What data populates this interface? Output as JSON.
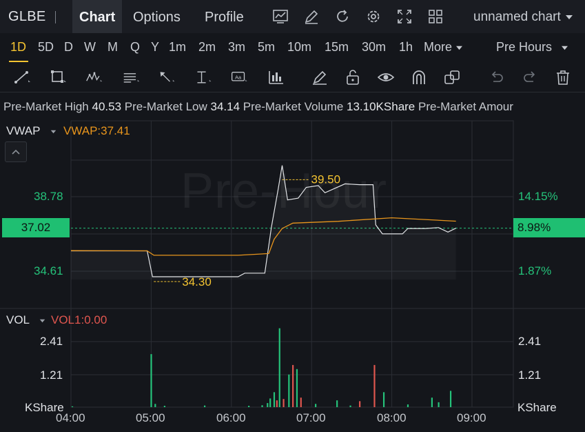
{
  "header": {
    "ticker": "GLBE",
    "tabs": [
      {
        "label": "Chart",
        "active": true
      },
      {
        "label": "Options",
        "active": false
      },
      {
        "label": "Profile",
        "active": false
      }
    ],
    "icons": [
      "chart-type-icon",
      "draw-pen-icon",
      "refresh-icon",
      "settings-gear-icon",
      "fullscreen-icon",
      "layout-grid-icon"
    ],
    "chart_name": "unnamed chart"
  },
  "timeframes": {
    "items": [
      "1D",
      "5D",
      "D",
      "W",
      "M",
      "Q",
      "Y",
      "1m",
      "2m",
      "3m",
      "5m",
      "10m",
      "15m",
      "30m",
      "1h"
    ],
    "active": "1D",
    "more_label": "More",
    "session_label": "Pre Hours"
  },
  "drawing_tools": [
    "trend-line-icon",
    "rectangle-icon",
    "pattern-icon",
    "fib-icon",
    "arrow-icon",
    "measure-icon",
    "text-icon",
    "indicator-icon",
    "brush-icon",
    "lock-icon",
    "eye-icon",
    "magnet-icon",
    "layers-icon",
    "undo-icon",
    "redo-icon",
    "trash-icon"
  ],
  "premarket": {
    "high_label": "Pre-Market High",
    "high_value": "40.53",
    "low_label": "Pre-Market Low",
    "low_value": "34.14",
    "volume_label": "Pre-Market Volume",
    "volume_value": "13.10KShare",
    "amount_label": "Pre-Market Amour"
  },
  "price_panel": {
    "indicator_name": "VWAP",
    "indicator_value": "VWAP:37.41",
    "watermark": "Pre-Hour",
    "left_ticks": [
      "38.78",
      "34.61"
    ],
    "right_ticks": [
      "14.15%",
      "1.87%"
    ],
    "current_price": "37.02",
    "current_change": "8.98%",
    "high_marker": "39.50",
    "low_marker": "34.30"
  },
  "volume_panel": {
    "indicator_name": "VOL",
    "indicator_value": "VOL1:0.00",
    "ticks": [
      "2.41",
      "1.21"
    ],
    "unit": "KShare"
  },
  "x_axis": [
    "04:00",
    "05:00",
    "06:00",
    "07:00",
    "08:00",
    "09:00"
  ],
  "colors": {
    "up": "#25c27a",
    "down": "#e0564f",
    "vwap": "#e8951c",
    "price_line": "#e3e5e8",
    "accent": "#f5c431"
  },
  "chart_data": {
    "type": "line",
    "x_unit": "minutes since 04:00",
    "price": {
      "name": "Price",
      "points": [
        [
          0,
          35.75
        ],
        [
          57,
          35.75
        ],
        [
          61,
          34.3
        ],
        [
          125,
          34.3
        ],
        [
          130,
          34.5
        ],
        [
          145,
          34.5
        ],
        [
          150,
          37.1
        ],
        [
          155,
          39.2
        ],
        [
          158,
          40.53
        ],
        [
          162,
          38.6
        ],
        [
          170,
          38.7
        ],
        [
          176,
          39.3
        ],
        [
          185,
          39.4
        ],
        [
          190,
          39.0
        ],
        [
          205,
          39.5
        ],
        [
          216,
          39.45
        ],
        [
          226,
          39.45
        ],
        [
          228,
          37.2
        ],
        [
          233,
          36.7
        ],
        [
          248,
          36.7
        ],
        [
          252,
          37.0
        ],
        [
          265,
          37.0
        ],
        [
          275,
          37.05
        ],
        [
          282,
          36.8
        ],
        [
          288,
          37.02
        ]
      ]
    },
    "vwap": {
      "name": "VWAP",
      "points": [
        [
          0,
          35.76
        ],
        [
          57,
          35.75
        ],
        [
          62,
          35.5
        ],
        [
          125,
          35.5
        ],
        [
          148,
          35.6
        ],
        [
          152,
          36.4
        ],
        [
          158,
          37.0
        ],
        [
          166,
          37.3
        ],
        [
          200,
          37.4
        ],
        [
          240,
          37.6
        ],
        [
          288,
          37.41
        ]
      ]
    },
    "volume": {
      "name": "VOL",
      "bars": [
        {
          "t": 1,
          "v": 0.03,
          "dir": "up"
        },
        {
          "t": 60,
          "v": 1.95,
          "dir": "up"
        },
        {
          "t": 63,
          "v": 0.12,
          "dir": "up"
        },
        {
          "t": 70,
          "v": 0.05,
          "dir": "up"
        },
        {
          "t": 100,
          "v": 0.06,
          "dir": "up"
        },
        {
          "t": 133,
          "v": 0.05,
          "dir": "up"
        },
        {
          "t": 143,
          "v": 0.07,
          "dir": "up"
        },
        {
          "t": 147,
          "v": 0.15,
          "dir": "up"
        },
        {
          "t": 149,
          "v": 0.32,
          "dir": "up"
        },
        {
          "t": 152,
          "v": 0.55,
          "dir": "up"
        },
        {
          "t": 154,
          "v": 0.25,
          "dir": "down"
        },
        {
          "t": 156,
          "v": 2.9,
          "dir": "up"
        },
        {
          "t": 159,
          "v": 0.3,
          "dir": "down"
        },
        {
          "t": 163,
          "v": 1.2,
          "dir": "up"
        },
        {
          "t": 166,
          "v": 1.55,
          "dir": "down"
        },
        {
          "t": 169,
          "v": 1.4,
          "dir": "up"
        },
        {
          "t": 172,
          "v": 0.35,
          "dir": "down"
        },
        {
          "t": 183,
          "v": 0.12,
          "dir": "up"
        },
        {
          "t": 199,
          "v": 0.25,
          "dir": "up"
        },
        {
          "t": 209,
          "v": 0.06,
          "dir": "up"
        },
        {
          "t": 216,
          "v": 0.22,
          "dir": "down"
        },
        {
          "t": 227,
          "v": 1.55,
          "dir": "down"
        },
        {
          "t": 234,
          "v": 0.55,
          "dir": "up"
        },
        {
          "t": 252,
          "v": 0.1,
          "dir": "up"
        },
        {
          "t": 270,
          "v": 0.35,
          "dir": "up"
        },
        {
          "t": 275,
          "v": 0.18,
          "dir": "up"
        },
        {
          "t": 284,
          "v": 0.6,
          "dir": "up"
        }
      ]
    },
    "x_ticks": [
      "04:00",
      "05:00",
      "06:00",
      "07:00",
      "08:00",
      "09:00"
    ],
    "grid": true
  }
}
